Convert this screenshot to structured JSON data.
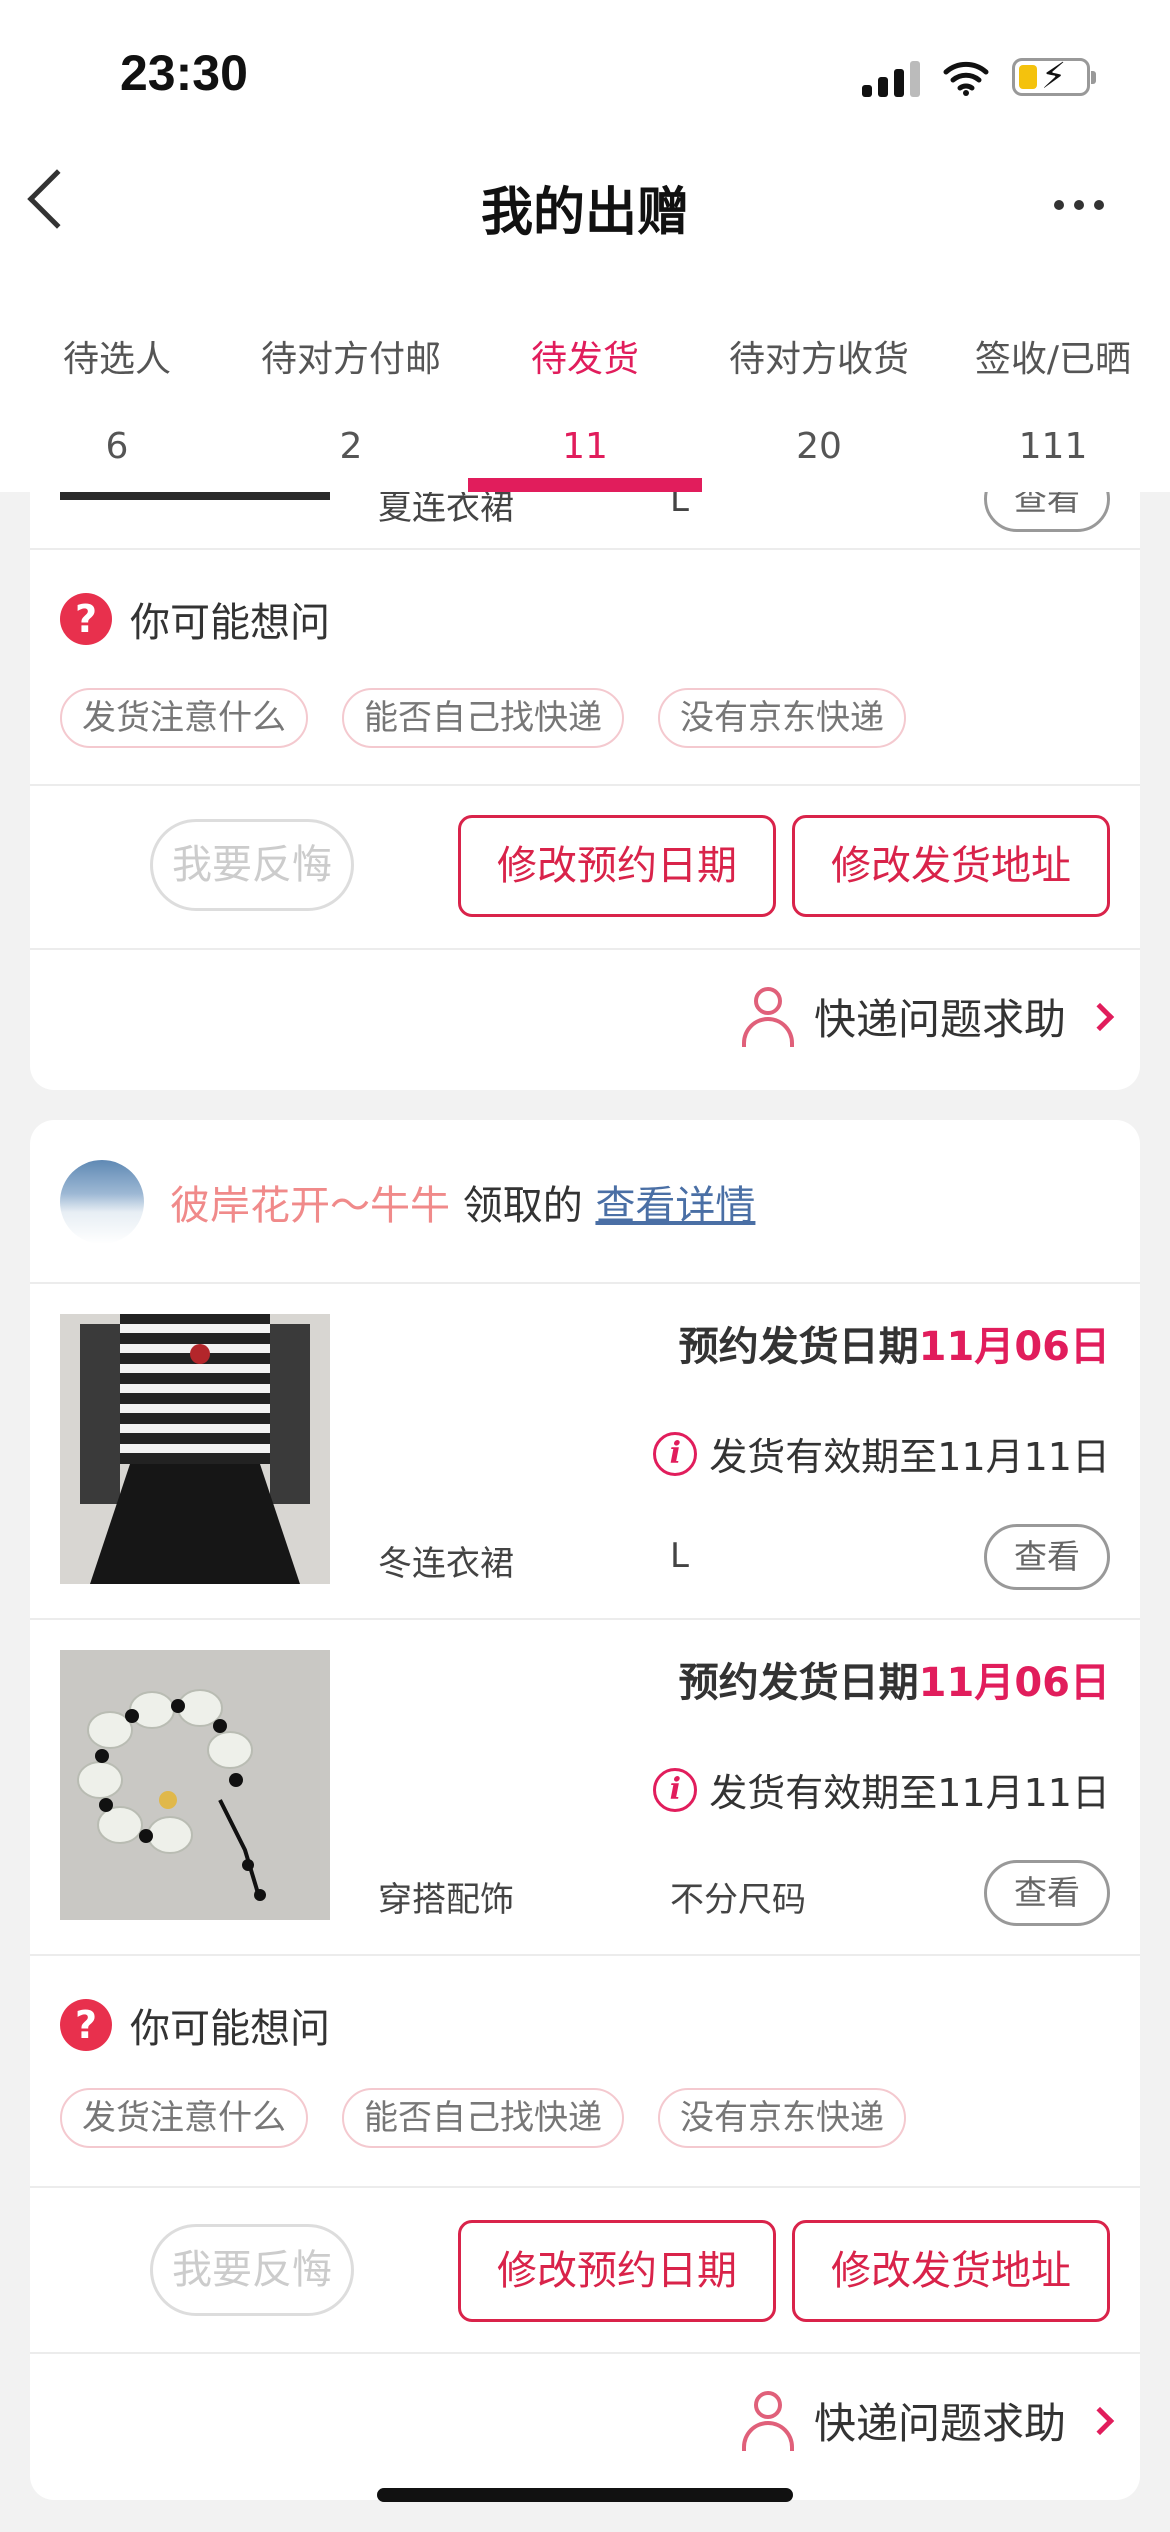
{
  "status_bar": {
    "time": "23:30"
  },
  "nav": {
    "title": "我的出赠"
  },
  "tabs": [
    {
      "label": "待选人",
      "count": "6",
      "active": false
    },
    {
      "label": "待对方付邮",
      "count": "2",
      "active": false
    },
    {
      "label": "待发货",
      "count": "11",
      "active": true
    },
    {
      "label": "待对方收货",
      "count": "20",
      "active": false
    },
    {
      "label": "签收/已晒",
      "count": "111",
      "active": false
    }
  ],
  "card1": {
    "partial_item": {
      "name": "夏连衣裙",
      "size": "L",
      "view_label": "查看"
    },
    "ask": {
      "title": "你可能想问",
      "chips": [
        "发货注意什么",
        "能否自己找快递",
        "没有京东快递"
      ]
    },
    "actions": {
      "regret": "我要反悔",
      "change_date": "修改预约日期",
      "change_address": "修改发货地址"
    },
    "help": "快递问题求助"
  },
  "card2": {
    "claimer": {
      "name": "彼岸花开～牛牛",
      "claimed": "领取的",
      "detail_link": "查看详情"
    },
    "items": [
      {
        "date_label": "预约发货日期",
        "date_value": "11月06日",
        "valid_text": "发货有效期至11月11日",
        "name": "冬连衣裙",
        "size": "L",
        "view_label": "查看"
      },
      {
        "date_label": "预约发货日期",
        "date_value": "11月06日",
        "valid_text": "发货有效期至11月11日",
        "name": "穿搭配饰",
        "size": "不分尺码",
        "view_label": "查看"
      }
    ],
    "ask": {
      "title": "你可能想问",
      "chips": [
        "发货注意什么",
        "能否自己找快递",
        "没有京东快递"
      ]
    },
    "actions": {
      "regret": "我要反悔",
      "change_date": "修改预约日期",
      "change_address": "修改发货地址"
    },
    "help": "快递问题求助"
  },
  "colors": {
    "accent": "#e11d5c",
    "claimer_name": "#f08a8a",
    "link": "#4a6fa5"
  }
}
